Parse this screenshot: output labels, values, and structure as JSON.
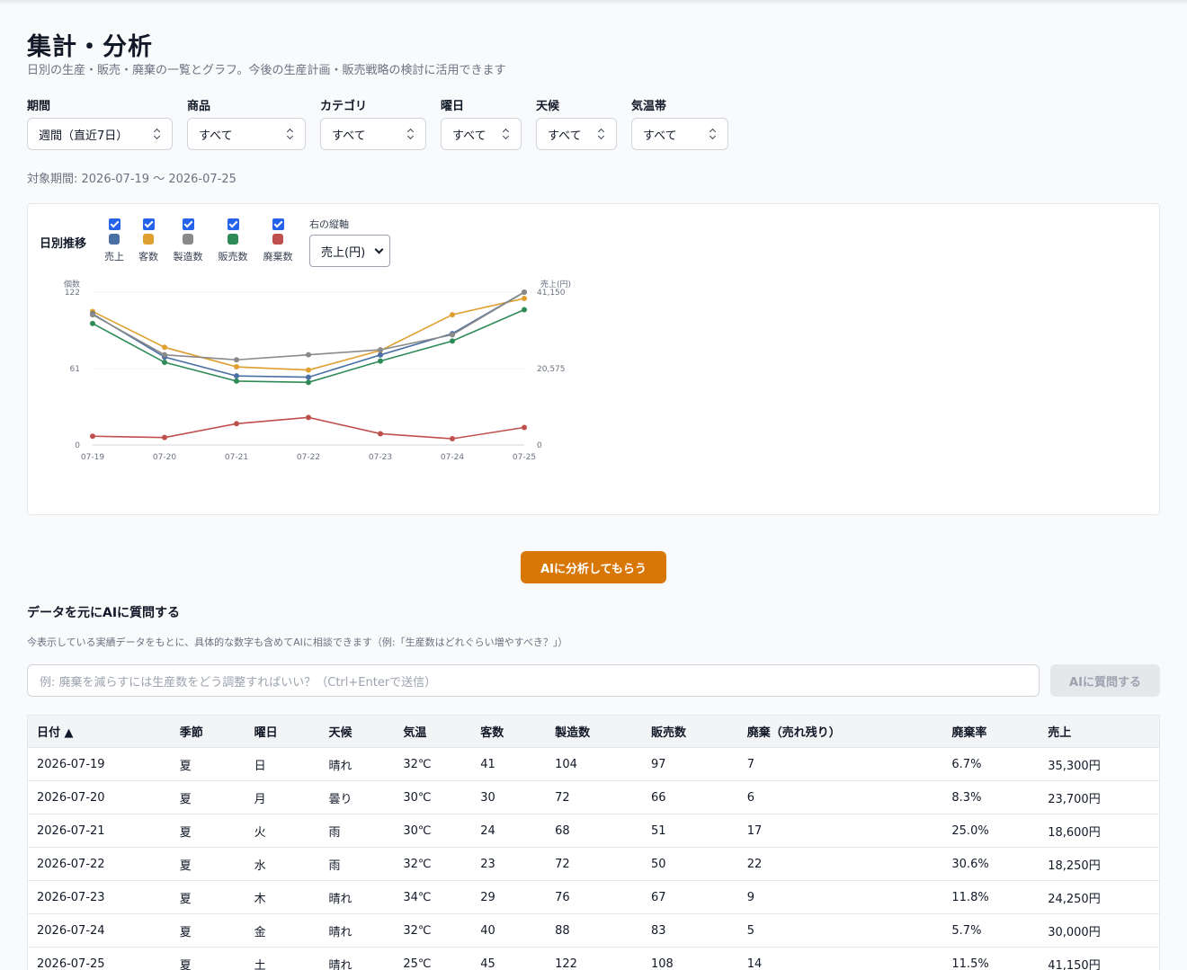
{
  "header": {
    "title": "集計・分析",
    "subtitle": "日別の生産・販売・廃棄の一覧とグラフ。今後の生産計画・販売戦略の検討に活用できます"
  },
  "filters": [
    {
      "label": "期間",
      "value": "週間（直近7日）"
    },
    {
      "label": "商品",
      "value": "すべて"
    },
    {
      "label": "カテゴリ",
      "value": "すべて"
    },
    {
      "label": "曜日",
      "value": "すべて"
    },
    {
      "label": "天候",
      "value": "すべて"
    },
    {
      "label": "気温帯",
      "value": "すべて"
    }
  ],
  "period_text": "対象期間: 2026-07-19 〜 2026-07-25",
  "chart_panel": {
    "title": "日別推移",
    "right_axis_label": "右の縦軸",
    "right_axis_value": "売上(円)"
  },
  "colors": {
    "sales": "#4a6fa5",
    "customers": "#e0a030",
    "production": "#8a8a8a",
    "sold": "#2e8b57",
    "waste": "#c0504d",
    "accent": "#d97706"
  },
  "chart_data": {
    "type": "line",
    "x": [
      "07-19",
      "07-20",
      "07-21",
      "07-22",
      "07-23",
      "07-24",
      "07-25"
    ],
    "left_axis": {
      "label": "個数",
      "ticks": [
        "0",
        "61",
        "122"
      ],
      "range": [
        0,
        122
      ]
    },
    "right_axis": {
      "label": "売上(円)",
      "ticks": [
        "0",
        "20,575",
        "41,150"
      ],
      "range": [
        0,
        41150
      ]
    },
    "series": [
      {
        "name": "売上",
        "axis": "right",
        "color": "#4a6fa5",
        "values": [
          35300,
          23700,
          18600,
          18250,
          24250,
          30000,
          41150
        ]
      },
      {
        "name": "客数",
        "axis": "left",
        "color": "#e0a030",
        "values": [
          41,
          30,
          24,
          23,
          29,
          40,
          45
        ]
      },
      {
        "name": "製造数",
        "axis": "left",
        "color": "#8a8a8a",
        "values": [
          104,
          72,
          68,
          72,
          76,
          88,
          122
        ]
      },
      {
        "name": "販売数",
        "axis": "left",
        "color": "#2e8b57",
        "values": [
          97,
          66,
          51,
          50,
          67,
          83,
          108
        ]
      },
      {
        "name": "廃棄数",
        "axis": "left",
        "color": "#c0504d",
        "values": [
          7,
          6,
          17,
          22,
          9,
          5,
          14
        ]
      }
    ],
    "customers_plot_scale": 2.6
  },
  "ai": {
    "analyze_label": "AIに分析してもらう",
    "ask_title": "データを元にAIに質問する",
    "ask_hint": "今表示している実績データをもとに、具体的な数字も含めてAIに相談できます（例:「生産数はどれぐらい増やすべき？」）",
    "input_placeholder": "例: 廃棄を減らすには生産数をどう調整すればいい？（Ctrl+Enterで送信）",
    "ask_button": "AIに質問する"
  },
  "table": {
    "columns": [
      "日付 ▲",
      "季節",
      "曜日",
      "天候",
      "気温",
      "客数",
      "製造数",
      "販売数",
      "廃棄（売れ残り）",
      "廃棄率",
      "売上"
    ],
    "rows": [
      [
        "2026-07-19",
        "夏",
        "日",
        "晴れ",
        "32℃",
        "41",
        "104",
        "97",
        "7",
        "6.7%",
        "35,300円"
      ],
      [
        "2026-07-20",
        "夏",
        "月",
        "曇り",
        "30℃",
        "30",
        "72",
        "66",
        "6",
        "8.3%",
        "23,700円"
      ],
      [
        "2026-07-21",
        "夏",
        "火",
        "雨",
        "30℃",
        "24",
        "68",
        "51",
        "17",
        "25.0%",
        "18,600円"
      ],
      [
        "2026-07-22",
        "夏",
        "水",
        "雨",
        "32℃",
        "23",
        "72",
        "50",
        "22",
        "30.6%",
        "18,250円"
      ],
      [
        "2026-07-23",
        "夏",
        "木",
        "晴れ",
        "34℃",
        "29",
        "76",
        "67",
        "9",
        "11.8%",
        "24,250円"
      ],
      [
        "2026-07-24",
        "夏",
        "金",
        "晴れ",
        "32℃",
        "40",
        "88",
        "83",
        "5",
        "5.7%",
        "30,000円"
      ],
      [
        "2026-07-25",
        "夏",
        "土",
        "晴れ",
        "25℃",
        "45",
        "122",
        "108",
        "14",
        "11.5%",
        "41,150円"
      ]
    ]
  }
}
